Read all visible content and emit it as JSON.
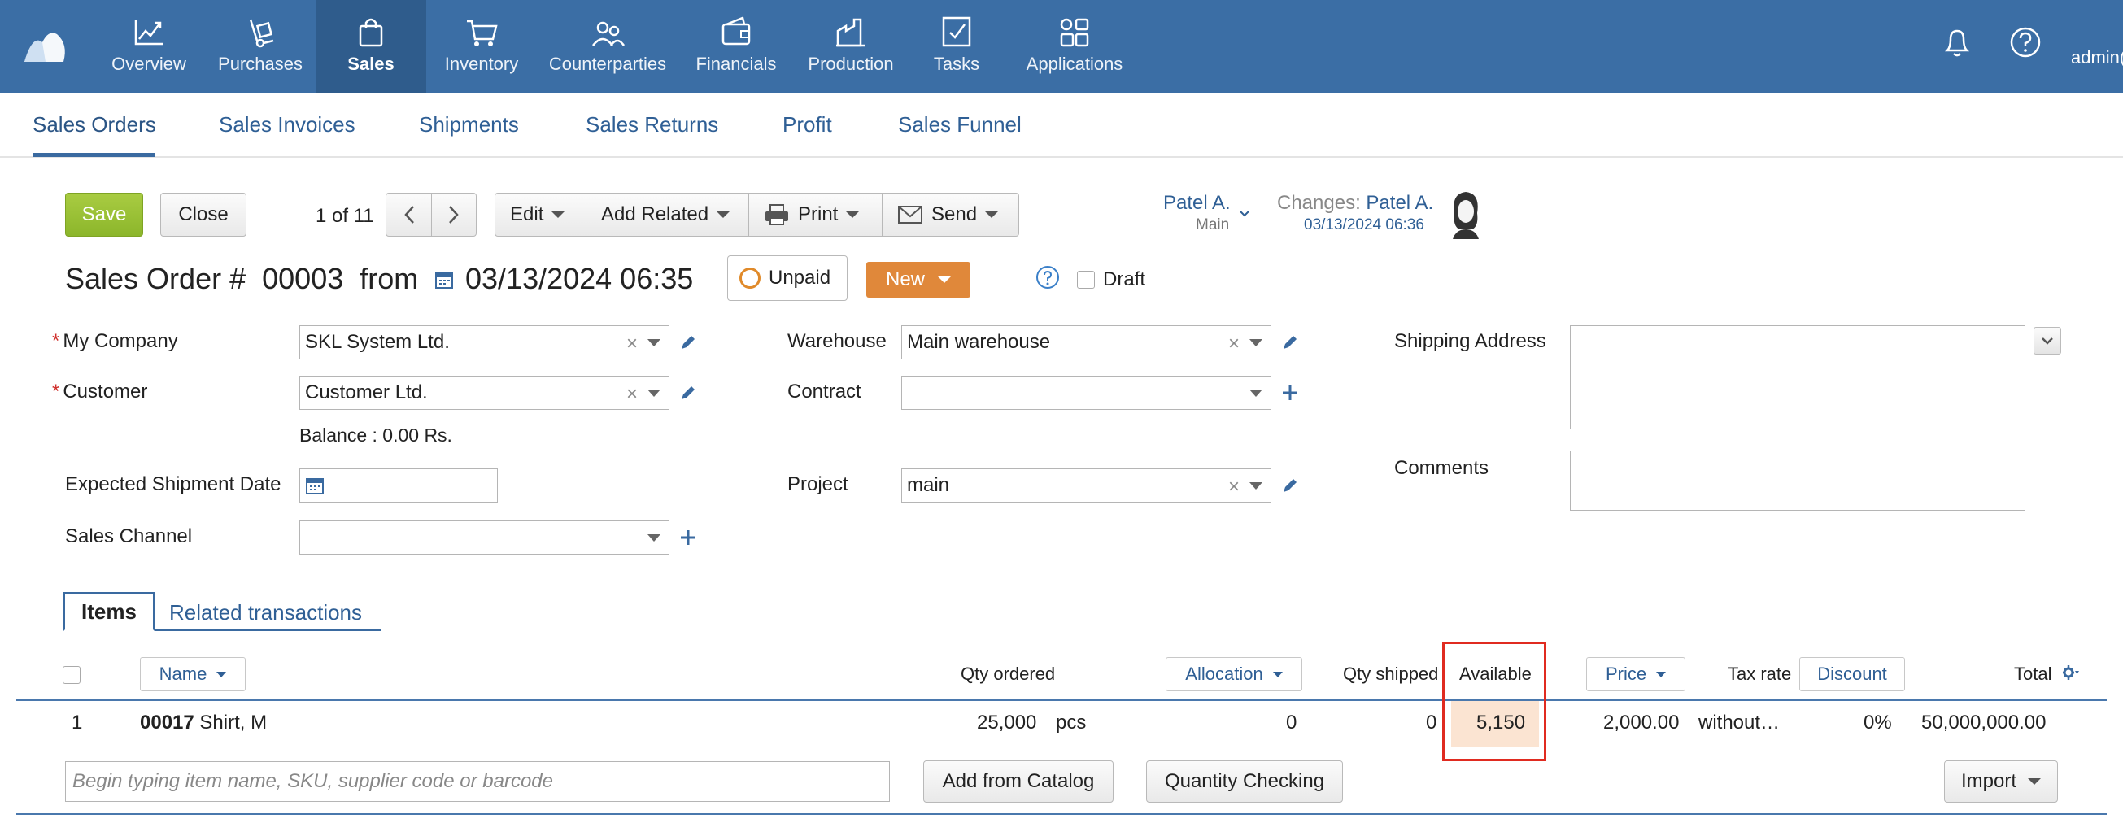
{
  "nav": {
    "items": [
      {
        "label": "Overview",
        "icon": "chart-line-icon"
      },
      {
        "label": "Purchases",
        "icon": "hand-truck-icon"
      },
      {
        "label": "Sales",
        "icon": "shopping-bag-icon"
      },
      {
        "label": "Inventory",
        "icon": "cart-icon"
      },
      {
        "label": "Counterparties",
        "icon": "people-icon"
      },
      {
        "label": "Financials",
        "icon": "wallet-icon"
      },
      {
        "label": "Production",
        "icon": "factory-icon"
      },
      {
        "label": "Tasks",
        "icon": "checkbox-icon"
      },
      {
        "label": "Applications",
        "icon": "apps-grid-icon"
      }
    ],
    "active": "Sales",
    "user": "admin("
  },
  "subtabs": [
    "Sales Orders",
    "Sales Invoices",
    "Shipments",
    "Sales Returns",
    "Profit",
    "Sales Funnel"
  ],
  "toolbar": {
    "save": "Save",
    "close": "Close",
    "pager": "1 of 11",
    "edit": "Edit",
    "add_related": "Add Related",
    "print": "Print",
    "send": "Send"
  },
  "owner": {
    "name": "Patel A.",
    "group": "Main",
    "changes_label": "Changes:",
    "changes_user": "Patel A.",
    "changes_date": "03/13/2024 06:36"
  },
  "order": {
    "title_prefix": "Sales Order #",
    "number": "00003",
    "from": "from",
    "date": "03/13/2024 06:35",
    "payment_status": "Unpaid",
    "status": "New",
    "draft_label": "Draft"
  },
  "form": {
    "my_company_label": "My Company",
    "my_company": "SKL System Ltd.",
    "customer_label": "Customer",
    "customer": "Customer Ltd.",
    "balance": "Balance : 0.00 Rs.",
    "shipment_date_label": "Expected Shipment Date",
    "sales_channel_label": "Sales Channel",
    "warehouse_label": "Warehouse",
    "warehouse": "Main warehouse",
    "contract_label": "Contract",
    "project_label": "Project",
    "project": "main",
    "shipping_address_label": "Shipping Address",
    "comments_label": "Comments",
    "clear_glyph": "×"
  },
  "item_tabs": [
    "Items",
    "Related transactions"
  ],
  "table": {
    "headers": {
      "name": "Name",
      "qty_ordered": "Qty ordered",
      "allocation": "Allocation",
      "qty_shipped": "Qty shipped",
      "available": "Available",
      "price": "Price",
      "tax_rate": "Tax rate",
      "discount": "Discount",
      "total": "Total"
    },
    "rows": [
      {
        "index": "1",
        "sku": "00017",
        "name": "Shirt, M",
        "qty": "25,000",
        "unit": "pcs",
        "allocation": "0",
        "shipped": "0",
        "available": "5,150",
        "price": "2,000.00",
        "tax": "without…",
        "discount": "0%",
        "total": "50,000,000.00"
      }
    ],
    "add_placeholder": "Begin typing item name, SKU, supplier code or barcode",
    "add_from_catalog": "Add from Catalog",
    "quantity_checking": "Quantity Checking",
    "import": "Import"
  },
  "colors": {
    "topbar": "#3b6ea5",
    "accent": "#2f5f95",
    "save": "#8cb62b",
    "new_status": "#e0883a",
    "highlight": "#e02b20"
  }
}
